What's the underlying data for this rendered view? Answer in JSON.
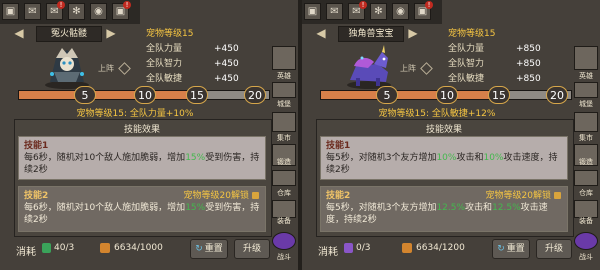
{
  "left": {
    "topbar_icons": [
      {
        "icon": "chest-icon",
        "glyph": "▣",
        "warn": false
      },
      {
        "icon": "mail-icon",
        "glyph": "✉",
        "warn": false
      },
      {
        "icon": "mail-alert-icon",
        "glyph": "✉",
        "warn": true
      },
      {
        "icon": "settings-icon",
        "glyph": "✻",
        "warn": false
      },
      {
        "icon": "color-wheel-icon",
        "glyph": "◉",
        "warn": false
      },
      {
        "icon": "event-alert-icon",
        "glyph": "▣",
        "warn": true
      }
    ],
    "pet_name": "冤火骷髅",
    "level_label": "宠物等级15",
    "stats": [
      {
        "label": "全队力量",
        "value": "+450"
      },
      {
        "label": "全队智力",
        "value": "+450"
      },
      {
        "label": "全队敏捷",
        "value": "+450"
      }
    ],
    "status": "上阵",
    "milestones": [
      "5",
      "10",
      "15",
      "20"
    ],
    "progress_fraction": 0.7,
    "bonus_text": "宠物等级15: 全队力量+10%",
    "skills_title": "技能效果",
    "skill1": {
      "title": "技能1",
      "pre": "每6秒，随机对10个敌人施加脆弱，增加",
      "hl": "15%",
      "post": "受到伤害，持续2秒"
    },
    "skill2": {
      "title": "技能2",
      "unlock": "宠物等级20解锁",
      "pre": "每6秒，随机对10个敌人施加脆弱，增加",
      "hl": "15%",
      "post": "受到伤害，持续2秒"
    },
    "consume_label": "消耗",
    "gem_count": "40/3",
    "cost": "6634/1000",
    "reset_label": "重置",
    "upgrade_label": "升级",
    "side_menu": [
      "英雄",
      "城堡",
      "集市",
      "锻造",
      "仓库",
      "装备",
      "战斗"
    ]
  },
  "right": {
    "topbar_icons": [
      {
        "icon": "chest-icon",
        "glyph": "▣",
        "warn": false
      },
      {
        "icon": "mail-icon",
        "glyph": "✉",
        "warn": false
      },
      {
        "icon": "mail-alert-icon",
        "glyph": "✉",
        "warn": true
      },
      {
        "icon": "settings-icon",
        "glyph": "✻",
        "warn": false
      },
      {
        "icon": "color-wheel-icon",
        "glyph": "◉",
        "warn": false
      },
      {
        "icon": "event-alert-icon",
        "glyph": "▣",
        "warn": true
      }
    ],
    "pet_name": "独角兽宝宝",
    "level_label": "宠物等级15",
    "stats": [
      {
        "label": "全队力量",
        "value": "+850"
      },
      {
        "label": "全队智力",
        "value": "+850"
      },
      {
        "label": "全队敏捷",
        "value": "+850"
      }
    ],
    "status": "上阵",
    "milestones": [
      "5",
      "10",
      "15",
      "20"
    ],
    "progress_fraction": 0.7,
    "bonus_text": "宠物等级15: 全队敏捷+12%",
    "skills_title": "技能效果",
    "skill1": {
      "title": "技能1",
      "pre": "每5秒，对随机3个友方增加",
      "hl": "10%",
      "mid": "攻击和",
      "hl2": "10%",
      "post": "攻击速度，持续2秒"
    },
    "skill2": {
      "title": "技能2",
      "unlock": "宠物等级20解锁",
      "pre": "每5秒，对随机3个友方增加",
      "hl": "12.5%",
      "mid": "攻击和",
      "hl2": "12.5%",
      "post": "攻击速度，持续2秒"
    },
    "consume_label": "消耗",
    "gem_count": "0/3",
    "cost": "6634/1200",
    "reset_label": "重置",
    "upgrade_label": "升级",
    "side_menu": [
      "英雄",
      "城堡",
      "集市",
      "锻造",
      "仓库",
      "装备",
      "战斗"
    ]
  },
  "colors": {
    "accent_orange": "#d6804a",
    "gold_text": "#f5c542",
    "highlight_green": "#44b84e"
  }
}
